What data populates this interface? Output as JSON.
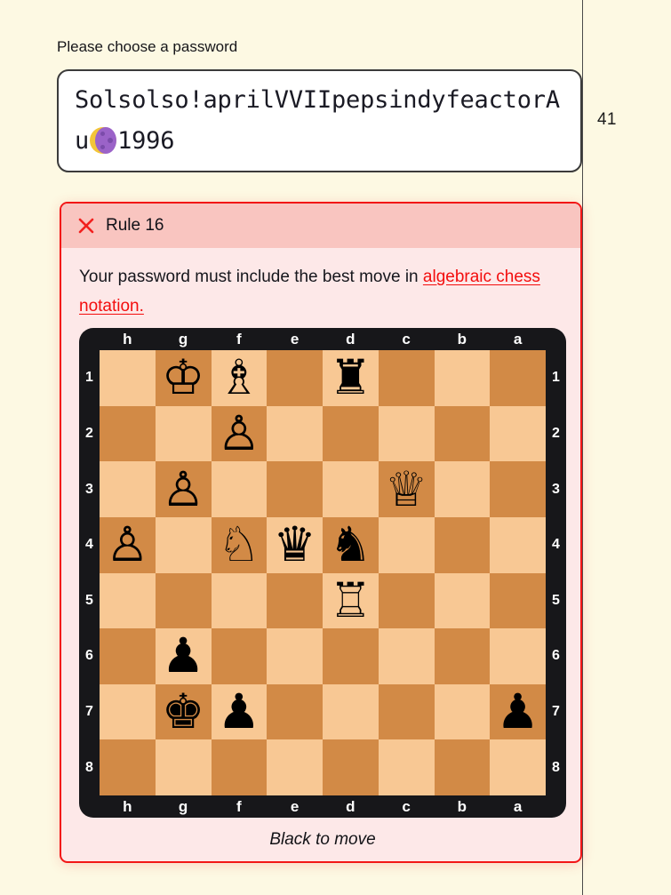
{
  "page": {
    "background_color": "#FDF9E3",
    "counter": "41"
  },
  "password_form": {
    "prompt_label": "Please choose a password",
    "value_part1": "Solsolso!aprilVVIIpepsindyfea",
    "value_part2": "ctorAu",
    "emoji_name": "moon-emoji",
    "value_part3": "1996",
    "placeholder": "Please choose a password",
    "full_value": "Solsolso!aprilVVIIpepsindyfeactorAu🌙 1996"
  },
  "rule": {
    "status_icon": "x-icon",
    "title": "Rule 16",
    "text_before_link": "Your password must include the best move in ",
    "link_text": "algebraic chess notation.",
    "border_color": "#F21616",
    "header_color": "#F9C5C0",
    "body_color": "#FDE8E8",
    "link_color": "#F30D0D"
  },
  "chess": {
    "orientation": "black",
    "files": [
      "h",
      "g",
      "f",
      "e",
      "d",
      "c",
      "b",
      "a"
    ],
    "ranks": [
      "1",
      "2",
      "3",
      "4",
      "5",
      "6",
      "7",
      "8"
    ],
    "light_square_color": "#F8C894",
    "dark_square_color": "#D28A46",
    "frame_color": "#17171A",
    "turn_label": "Black to move",
    "pieces": [
      {
        "square": "g1",
        "color": "white",
        "type": "king",
        "glyph": "♔"
      },
      {
        "square": "f1",
        "color": "white",
        "type": "bishop",
        "glyph": "♗"
      },
      {
        "square": "d1",
        "color": "black",
        "type": "rook",
        "glyph": "♜"
      },
      {
        "square": "f2",
        "color": "white",
        "type": "pawn",
        "glyph": "♙"
      },
      {
        "square": "g3",
        "color": "white",
        "type": "pawn",
        "glyph": "♙"
      },
      {
        "square": "c3",
        "color": "white",
        "type": "queen",
        "glyph": "♕"
      },
      {
        "square": "h4",
        "color": "white",
        "type": "pawn",
        "glyph": "♙"
      },
      {
        "square": "f4",
        "color": "white",
        "type": "knight",
        "glyph": "♘"
      },
      {
        "square": "e4",
        "color": "black",
        "type": "queen",
        "glyph": "♛"
      },
      {
        "square": "d4",
        "color": "black",
        "type": "knight",
        "glyph": "♞"
      },
      {
        "square": "d5",
        "color": "white",
        "type": "rook",
        "glyph": "♖"
      },
      {
        "square": "g6",
        "color": "black",
        "type": "pawn",
        "glyph": "♟"
      },
      {
        "square": "g7",
        "color": "black",
        "type": "king",
        "glyph": "♚"
      },
      {
        "square": "f7",
        "color": "black",
        "type": "pawn",
        "glyph": "♟"
      },
      {
        "square": "a7",
        "color": "black",
        "type": "pawn",
        "glyph": "♟"
      }
    ]
  }
}
